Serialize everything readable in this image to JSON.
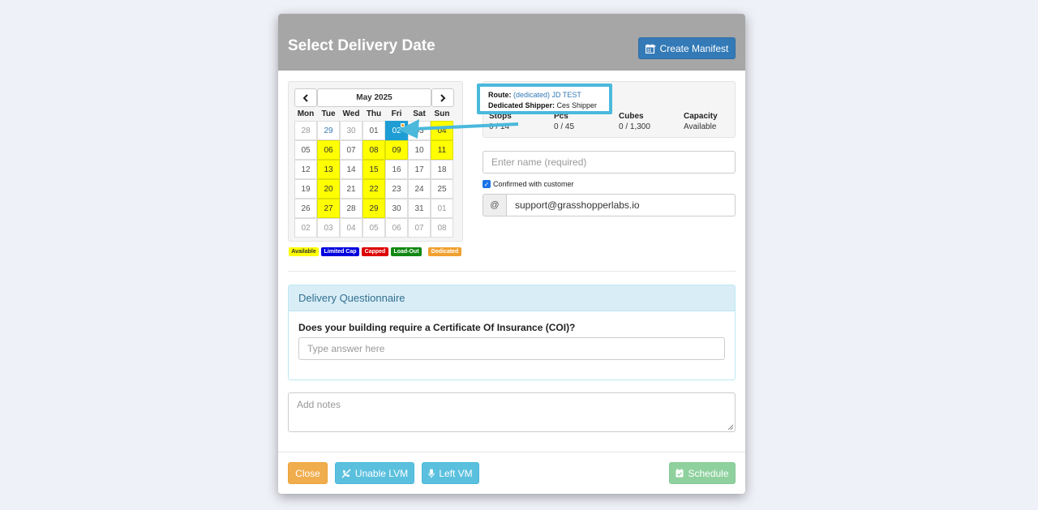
{
  "modal": {
    "title": "Select Delivery Date",
    "create_manifest_label": "Create Manifest",
    "create_manifest_icon": "calendar-plus-icon"
  },
  "calendar": {
    "month_label": "May 2025",
    "prev_icon": "chevron-left-icon",
    "next_icon": "chevron-right-icon",
    "weekdays": [
      "Mon",
      "Tue",
      "Wed",
      "Thu",
      "Fri",
      "Sat",
      "Sun"
    ],
    "weeks": [
      [
        {
          "d": "28",
          "s": "muted"
        },
        {
          "d": "29",
          "s": "link"
        },
        {
          "d": "30",
          "s": "muted"
        },
        {
          "d": "01",
          "s": "normal"
        },
        {
          "d": "02",
          "s": "selected"
        },
        {
          "d": "03",
          "s": "normal"
        },
        {
          "d": "04",
          "s": "available"
        }
      ],
      [
        {
          "d": "05",
          "s": "normal"
        },
        {
          "d": "06",
          "s": "available"
        },
        {
          "d": "07",
          "s": "normal"
        },
        {
          "d": "08",
          "s": "available"
        },
        {
          "d": "09",
          "s": "available"
        },
        {
          "d": "10",
          "s": "normal"
        },
        {
          "d": "11",
          "s": "available"
        }
      ],
      [
        {
          "d": "12",
          "s": "normal"
        },
        {
          "d": "13",
          "s": "available"
        },
        {
          "d": "14",
          "s": "normal"
        },
        {
          "d": "15",
          "s": "available"
        },
        {
          "d": "16",
          "s": "normal"
        },
        {
          "d": "17",
          "s": "normal"
        },
        {
          "d": "18",
          "s": "normal"
        }
      ],
      [
        {
          "d": "19",
          "s": "normal"
        },
        {
          "d": "20",
          "s": "available"
        },
        {
          "d": "21",
          "s": "normal"
        },
        {
          "d": "22",
          "s": "available"
        },
        {
          "d": "23",
          "s": "normal"
        },
        {
          "d": "24",
          "s": "normal"
        },
        {
          "d": "25",
          "s": "normal"
        }
      ],
      [
        {
          "d": "26",
          "s": "normal"
        },
        {
          "d": "27",
          "s": "available"
        },
        {
          "d": "28",
          "s": "normal"
        },
        {
          "d": "29",
          "s": "available"
        },
        {
          "d": "30",
          "s": "normal"
        },
        {
          "d": "31",
          "s": "normal"
        },
        {
          "d": "01",
          "s": "muted"
        }
      ],
      [
        {
          "d": "02",
          "s": "muted"
        },
        {
          "d": "03",
          "s": "muted"
        },
        {
          "d": "04",
          "s": "muted"
        },
        {
          "d": "05",
          "s": "muted"
        },
        {
          "d": "06",
          "s": "muted"
        },
        {
          "d": "07",
          "s": "muted"
        },
        {
          "d": "08",
          "s": "muted"
        }
      ]
    ],
    "legend": [
      {
        "label": "Available",
        "bg": "#ffff00",
        "fg": "#333333"
      },
      {
        "label": "Limited Cap",
        "bg": "#0000dd",
        "fg": "#ffffff"
      },
      {
        "label": "Capped",
        "bg": "#dd0000",
        "fg": "#ffffff"
      },
      {
        "label": "Load-Out",
        "bg": "#118811",
        "fg": "#ffffff"
      },
      {
        "label": "Dedicated",
        "bg": "#f0a030",
        "fg": "#ffffff"
      }
    ]
  },
  "route_info": {
    "route_label": "Route:",
    "route_value": "(dedicated) JD TEST",
    "shipper_label": "Dedicated Shipper:",
    "shipper_value": "Ces Shipper",
    "headers": [
      "Stops",
      "Pcs",
      "Cubes",
      "Capacity"
    ],
    "values": [
      "0 / 14",
      "0 / 45",
      "0 / 1,300",
      "Available"
    ]
  },
  "form": {
    "name_placeholder": "Enter name (required)",
    "confirmed_label": "Confirmed with customer",
    "email_addon": "@",
    "email_value": "support@grasshopperlabs.io"
  },
  "questionnaire": {
    "title": "Delivery Questionnaire",
    "question": "Does your building require a Certificate Of Insurance (COI)?",
    "answer_placeholder": "Type answer here"
  },
  "notes": {
    "placeholder": "Add notes"
  },
  "footer": {
    "close_label": "Close",
    "unable_lvm_label": "Unable LVM",
    "left_vm_label": "Left VM",
    "schedule_label": "Schedule"
  },
  "colors": {
    "header_bg": "#a6a6a6",
    "primary": "#337ab7",
    "selected_day": "#1d9dd4",
    "available": "#ffff00",
    "close_btn": "#f0ad4e",
    "info_btn": "#5bc0de",
    "schedule_btn": "#8fd19e",
    "callout": "#4ab9dc"
  }
}
